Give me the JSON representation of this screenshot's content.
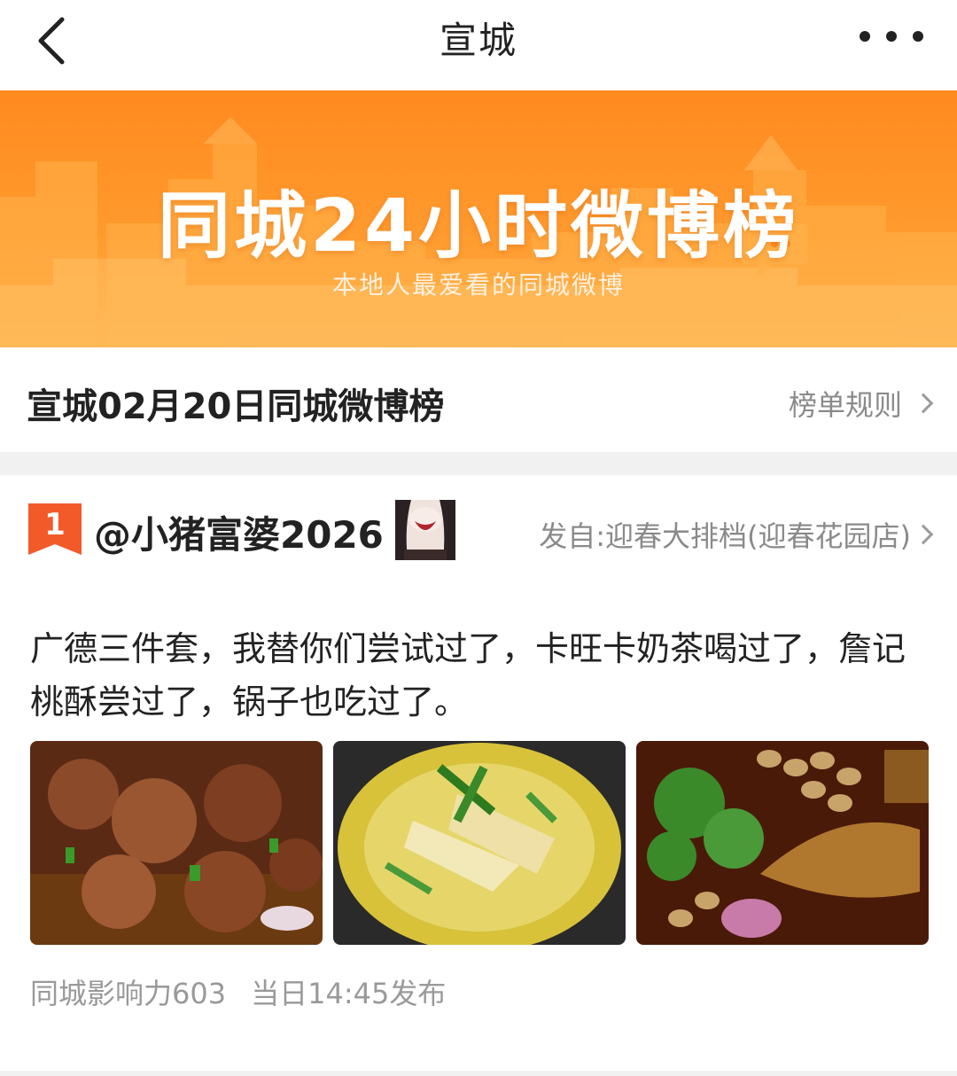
{
  "nav": {
    "title": "宣城"
  },
  "banner": {
    "title": "同城24小时微博榜",
    "subtitle": "本地人最爱看的同城微博"
  },
  "section": {
    "title": "宣城02月20日同城微博榜",
    "rules_label": "榜单规则"
  },
  "post": {
    "rank": "1",
    "username": "@小猪富婆2026",
    "from": "发自:迎春大排档(迎春花园店)",
    "text": "广德三件套，我替你们尝试过了，卡旺卡奶茶喝过了，詹记桃酥尝过了，锅子也吃过了。",
    "influence": "同城影响力603",
    "published": "当日14:45发布",
    "photos": [
      {
        "name": "braised-pork-ribs-photo"
      },
      {
        "name": "bamboo-shoot-soup-photo"
      },
      {
        "name": "fish-with-peanuts-photo"
      }
    ]
  },
  "colors": {
    "accent": "#ff8a1f",
    "rank_badge": "#f25a2a",
    "muted_text": "#8a8a8a"
  },
  "icons": {
    "back": "chevron-left-icon",
    "more": "more-dots-icon",
    "chevron": "chevron-right-icon",
    "bubble": "chat-bubble-icon"
  }
}
